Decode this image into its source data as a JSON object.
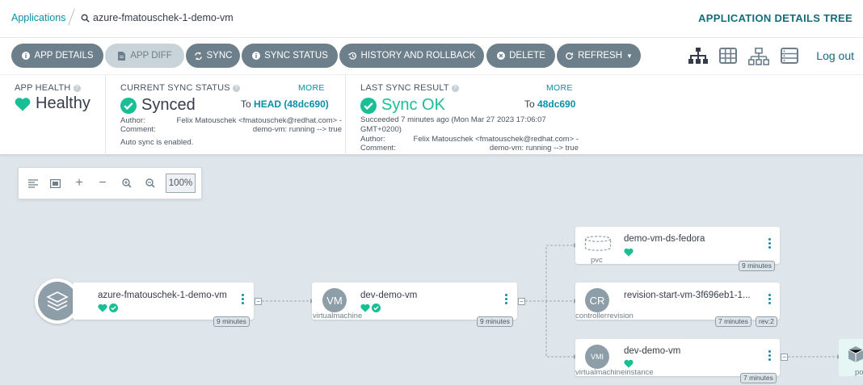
{
  "breadcrumb": {
    "link": "Applications",
    "current": "azure-fmatouschek-1-demo-vm"
  },
  "page_title": "APPLICATION DETAILS TREE",
  "toolbar": {
    "app_details": "APP DETAILS",
    "app_diff": "APP DIFF",
    "sync": "SYNC",
    "sync_status": "SYNC STATUS",
    "history": "HISTORY AND ROLLBACK",
    "delete": "DELETE",
    "refresh": "REFRESH",
    "logout": "Log out"
  },
  "health": {
    "label": "APP HEALTH",
    "value": "Healthy"
  },
  "current_sync": {
    "label": "CURRENT SYNC STATUS",
    "more": "MORE",
    "value": "Synced",
    "to_prefix": "To",
    "to_rev": "HEAD (48dc690)",
    "author_key": "Author:",
    "author_val": "Felix Matouschek <fmatouschek@redhat.com> -",
    "comment_key": "Comment:",
    "comment_val": "demo-vm: running --> true",
    "auto_sync": "Auto sync is enabled."
  },
  "last_sync": {
    "label": "LAST SYNC RESULT",
    "more": "MORE",
    "value": "Sync OK",
    "to_prefix": "To",
    "to_rev": "48dc690",
    "succeeded_line1": "Succeeded 7 minutes ago (Mon Mar 27 2023 17:06:07",
    "succeeded_line2": "GMT+0200)",
    "author_key": "Author:",
    "author_val": "Felix Matouschek <fmatouschek@redhat.com> -",
    "comment_key": "Comment:",
    "comment_val": "demo-vm: running --> true"
  },
  "zoom": {
    "level": "100%"
  },
  "nodes": {
    "app": {
      "name": "azure-fmatouschek-1-demo-vm",
      "age": "9 minutes"
    },
    "vm": {
      "abbr": "VM",
      "name": "dev-demo-vm",
      "kind": "virtualmachine",
      "age": "9 minutes"
    },
    "pvc": {
      "name": "demo-vm-ds-fedora",
      "kind": "pvc",
      "age": "9 minutes"
    },
    "cr": {
      "abbr": "CR",
      "name": "revision-start-vm-3f696eb1-1...",
      "kind": "controllerrevision",
      "age": "7 minutes",
      "rev": "rev:2"
    },
    "vmi": {
      "abbr": "VMI",
      "name": "dev-demo-vm",
      "kind": "virtualmachineinstance",
      "age": "7 minutes"
    },
    "pod": {
      "kind": "po"
    }
  },
  "colors": {
    "accent": "#0b8fa5",
    "healthy": "#18be94",
    "button": "#6d7f8b"
  }
}
